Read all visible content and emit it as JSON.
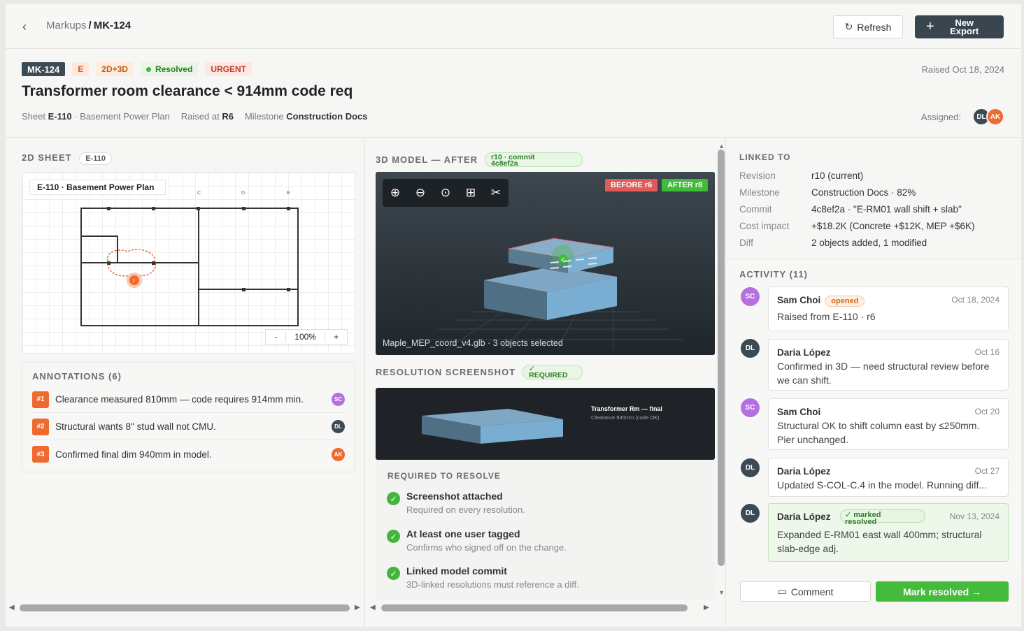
{
  "breadcrumb": {
    "parent": "Markups",
    "sep": "/",
    "current": "MK-124"
  },
  "toolbar": {
    "refresh_label": "Refresh",
    "new_export_line1": "New",
    "new_export_line2": "Export"
  },
  "issue": {
    "id": "MK-124",
    "discipline": "E",
    "mode": "2D+3D",
    "status": "Resolved",
    "priority": "URGENT",
    "raised_date": "Raised Oct 18, 2024",
    "title": "Transformer room clearance < 914mm code req",
    "sheet_label": "Sheet",
    "sheet": "E-110",
    "sheet_name": "· Basement Power Plan",
    "raised_at_label": "Raised at",
    "raised_at": "R6",
    "milestone_label": "Milestone",
    "milestone": "Construction Docs",
    "assigned_label": "Assigned:",
    "assignees": [
      "DL",
      "AK"
    ]
  },
  "sheet_panel": {
    "heading": "2D SHEET",
    "chip": "E-110",
    "title": "E-110 · Basement Power Plan",
    "grid_labels": [
      "C",
      "D",
      "E"
    ],
    "zoom_minus": "-",
    "zoom": "100%",
    "zoom_plus": "+"
  },
  "annotations": {
    "heading": "ANNOTATIONS (6)",
    "items": [
      {
        "num": "#1",
        "text": "Clearance measured 810mm — code requires 914mm min.",
        "who": "SC"
      },
      {
        "num": "#2",
        "text": "Structural wants 8\" stud wall not CMU.",
        "who": "DL"
      },
      {
        "num": "#3",
        "text": "Confirmed final dim 940mm in model.",
        "who": "AK"
      }
    ]
  },
  "model_panel": {
    "heading": "3D MODEL — AFTER",
    "commit_chip_line1": "r10 · commit",
    "commit_chip_line2": "4c8ef2a",
    "before": "BEFORE r6",
    "after": "AFTER r8",
    "caption": "Maple_MEP_coord_v4.glb · 3 objects selected",
    "tools": [
      "move-icon",
      "minus-circle-icon",
      "target-icon",
      "grid-icon",
      "scissors-icon"
    ]
  },
  "screenshot_panel": {
    "heading": "RESOLUTION SCREENSHOT",
    "chip_check": "✓",
    "chip": "REQUIRED",
    "caption_title": "Transformer Rm — final",
    "caption_sub": "Clearance 940mm (code OK)"
  },
  "requirements": {
    "heading": "REQUIRED TO RESOLVE",
    "items": [
      {
        "title": "Screenshot attached",
        "sub": "Required on every resolution."
      },
      {
        "title": "At least one user tagged",
        "sub": "Confirms who signed off on the change."
      },
      {
        "title": "Linked model commit",
        "sub": "3D-linked resolutions must reference a diff."
      }
    ]
  },
  "linked": {
    "heading": "LINKED TO",
    "rows": [
      {
        "k": "Revision",
        "v": "r10 (current)"
      },
      {
        "k": "Milestone",
        "v": "Construction Docs · 82%"
      },
      {
        "k": "Commit",
        "v": "4c8ef2a · \"E-RM01 wall shift + slab\""
      },
      {
        "k": "Cost impact",
        "v": "+$18.2K (Concrete +$12K, MEP +$6K)"
      },
      {
        "k": "Diff",
        "v": "2 objects added, 1 modified"
      }
    ]
  },
  "activity": {
    "heading": "ACTIVITY (11)",
    "items": [
      {
        "av": "SC",
        "who": "Sam Choi",
        "pill": "opened",
        "when": "Oct 18, 2024",
        "text": "Raised from E-110 · r6"
      },
      {
        "av": "DL",
        "who": "Daria López",
        "when": "Oct 16",
        "text": "Confirmed in 3D — need structural review before we can shift."
      },
      {
        "av": "SC",
        "who": "Sam Choi",
        "when": "Oct 20",
        "text": "Structural OK to shift column east by ≤250mm. Pier unchanged."
      },
      {
        "av": "DL",
        "who": "Daria López",
        "when": "Oct 27",
        "text": "Updated S-COL-C.4 in the model. Running diff..."
      },
      {
        "av": "DL",
        "who": "Daria López",
        "pill_line1": "✓ marked",
        "pill_line2": "resolved",
        "when": "Nov 13, 2024",
        "text": "Expanded E-RM01 east wall 400mm; structural slab-edge adj."
      }
    ]
  },
  "footer": {
    "comment": "Comment",
    "mark_resolved": "Mark resolved →"
  },
  "colors": {
    "accent_green": "#45bb3c",
    "dark": "#3c4a55",
    "orange": "#ef6a2f"
  }
}
